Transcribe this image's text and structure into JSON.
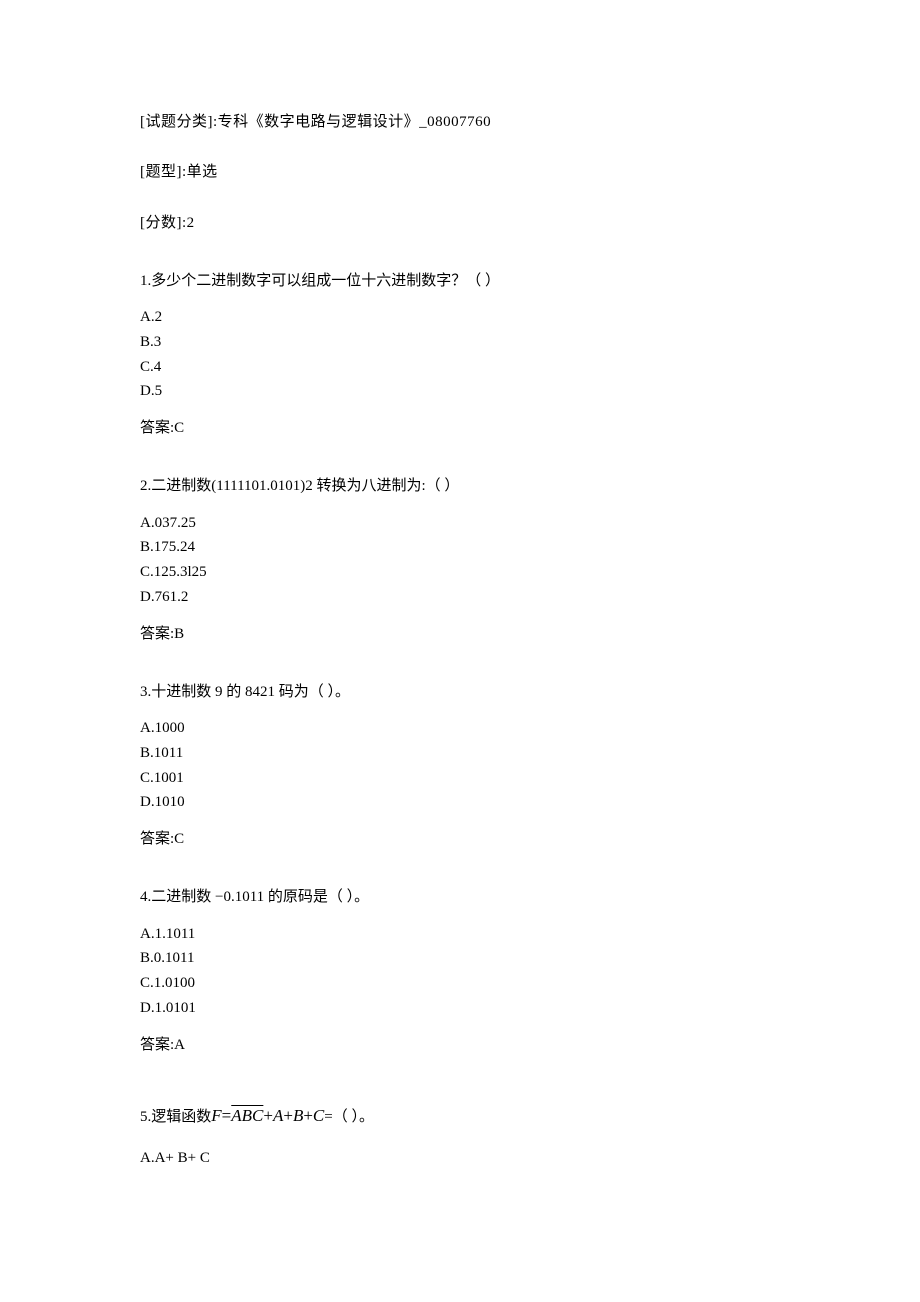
{
  "meta": {
    "category_label": "[试题分类]:",
    "category_value": "专科《数字电路与逻辑设计》_08007760",
    "type_label": "[题型]:",
    "type_value": "单选",
    "score_label": "[分数]:",
    "score_value": "2"
  },
  "questions": [
    {
      "num": "1.",
      "text": "多少个二进制数字可以组成一位十六进制数字？（      ）",
      "options": [
        {
          "label": "A.",
          "value": "2"
        },
        {
          "label": "B.",
          "value": "3"
        },
        {
          "label": "C.",
          "value": "4"
        },
        {
          "label": "D.",
          "value": "5"
        }
      ],
      "answer_label": "答案:",
      "answer_value": "C"
    },
    {
      "num": "2.",
      "text": "二进制数(1111101.0101)2 转换为八进制为:（      ）",
      "options": [
        {
          "label": "A.",
          "value": "037.25"
        },
        {
          "label": "B.",
          "value": "175.24"
        },
        {
          "label": "C.",
          "value": "125.3l25"
        },
        {
          "label": "D.",
          "value": "761.2"
        }
      ],
      "answer_label": "答案:",
      "answer_value": "B"
    },
    {
      "num": "3.",
      "text": "十进制数 9 的 8421 码为（        ）。",
      "options": [
        {
          "label": "A.",
          "value": "1000"
        },
        {
          "label": "B.",
          "value": "1011"
        },
        {
          "label": "C.",
          "value": "1001"
        },
        {
          "label": "D.",
          "value": "1010"
        }
      ],
      "answer_label": "答案:",
      "answer_value": "C"
    },
    {
      "num": "4.",
      "text": "二进制数 −0.1011 的原码是（        ）。",
      "options": [
        {
          "label": "A.",
          "value": "1.1011"
        },
        {
          "label": "B.",
          "value": "0.1011"
        },
        {
          "label": "C.",
          "value": "1.0100"
        },
        {
          "label": "D.",
          "value": "1.0101"
        }
      ],
      "answer_label": "答案:",
      "answer_value": "A"
    }
  ],
  "q5": {
    "num": "5.",
    "prefix": "逻辑函数",
    "F": "F",
    "eq": " = ",
    "abc": "ABC",
    "plus1": " + ",
    "A": "A",
    "plus2": " + ",
    "B": "B",
    "plus3": " + ",
    "C": "C",
    "tail": " =（          ）。",
    "options": [
      {
        "label": "A.",
        "value": "A+ B+ C"
      }
    ]
  }
}
